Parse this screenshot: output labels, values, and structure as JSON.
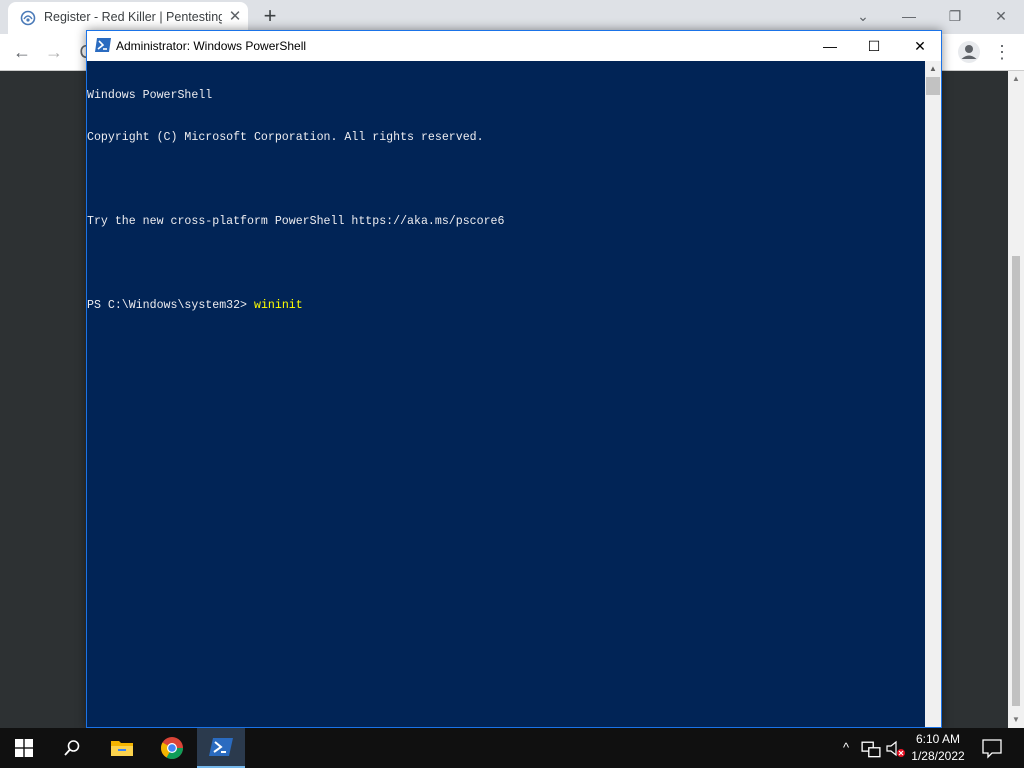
{
  "browser": {
    "tab_title": "Register - Red Killer | Pentesting",
    "tab_close": "✕",
    "new_tab": "+",
    "controls": {
      "tab_search": "⌄",
      "minimize": "—",
      "restore": "❐",
      "close": "✕"
    },
    "toolbar": {
      "back": "←",
      "forward": "→",
      "reload": "C",
      "menu": "⋮"
    }
  },
  "powershell": {
    "title": "Administrator: Windows PowerShell",
    "controls": {
      "minimize": "—",
      "maximize": "☐",
      "close": "✕"
    },
    "lines": [
      "Windows PowerShell",
      "Copyright (C) Microsoft Corporation. All rights reserved.",
      "",
      "Try the new cross-platform PowerShell https://aka.ms/pscore6",
      ""
    ],
    "prompt": "PS C:\\Windows\\system32> ",
    "command": "wininit",
    "colors": {
      "background": "#012456",
      "text": "#eeedf0",
      "command": "#ffff00"
    }
  },
  "taskbar": {
    "time": "6:10 AM",
    "date": "1/28/2022",
    "icons": [
      "windows-start-icon",
      "search-icon",
      "file-explorer-icon",
      "chrome-icon",
      "powershell-icon"
    ],
    "tray": {
      "chevron": "^"
    }
  }
}
